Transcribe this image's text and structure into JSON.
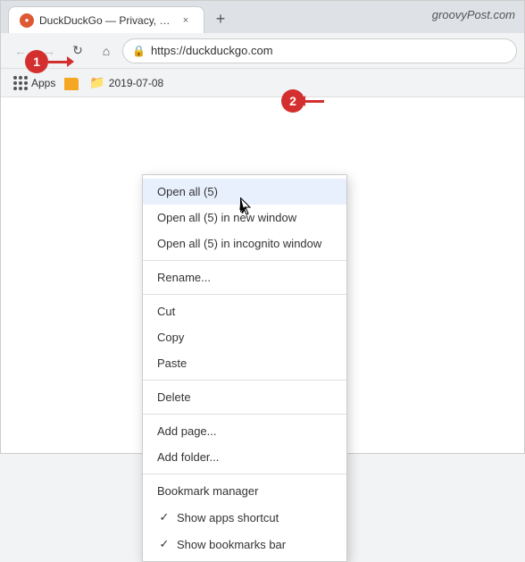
{
  "browser": {
    "tab": {
      "favicon_alt": "DuckDuckGo favicon",
      "title": "DuckDuckGo — Privacy, simplifi...",
      "close_label": "×"
    },
    "new_tab_label": "+",
    "groovy_post_text": "groovyPost.com",
    "nav": {
      "back_label": "←",
      "forward_label": "→",
      "reload_label": "↻",
      "home_label": "⌂",
      "address": "https://duckduckgo.com",
      "lock_icon": "🔒"
    },
    "bookmarks_bar": {
      "apps_label": "Apps",
      "folder_name": "2019-07-08"
    }
  },
  "context_menu": {
    "items": [
      {
        "id": "open-all",
        "label": "Open all (5)",
        "highlighted": true
      },
      {
        "id": "open-all-new-window",
        "label": "Open all (5) in new window",
        "highlighted": false
      },
      {
        "id": "open-all-incognito",
        "label": "Open all (5) in incognito window",
        "highlighted": false
      },
      {
        "id": "sep1",
        "type": "separator"
      },
      {
        "id": "rename",
        "label": "Rename...",
        "highlighted": false
      },
      {
        "id": "sep2",
        "type": "separator"
      },
      {
        "id": "cut",
        "label": "Cut",
        "highlighted": false
      },
      {
        "id": "copy",
        "label": "Copy",
        "highlighted": false
      },
      {
        "id": "paste",
        "label": "Paste",
        "highlighted": false
      },
      {
        "id": "sep3",
        "type": "separator"
      },
      {
        "id": "delete",
        "label": "Delete",
        "highlighted": false
      },
      {
        "id": "sep4",
        "type": "separator"
      },
      {
        "id": "add-page",
        "label": "Add page...",
        "highlighted": false
      },
      {
        "id": "add-folder",
        "label": "Add folder...",
        "highlighted": false
      },
      {
        "id": "sep5",
        "type": "separator"
      },
      {
        "id": "bookmark-manager",
        "label": "Bookmark manager",
        "highlighted": false
      },
      {
        "id": "show-apps",
        "label": "Show apps shortcut",
        "check": true,
        "highlighted": false
      },
      {
        "id": "show-bookmarks",
        "label": "Show bookmarks bar",
        "check": true,
        "highlighted": false
      }
    ]
  },
  "annotations": {
    "badge_1": "1",
    "badge_2": "2"
  }
}
